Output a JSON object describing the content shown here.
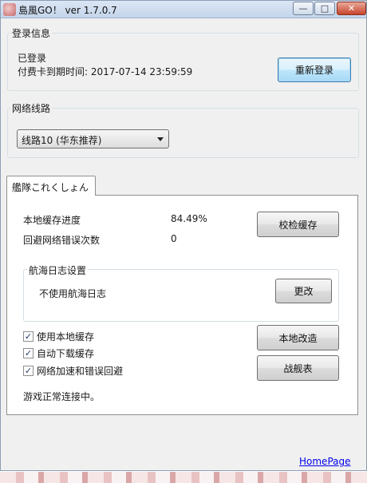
{
  "window": {
    "title": "島風GO！ ver 1.7.0.7",
    "min_glyph": "—",
    "max_glyph": "□",
    "close_glyph": "✕"
  },
  "login": {
    "legend": "登录信息",
    "status": "已登录",
    "expiry_text": "付费卡到期时间: 2017-07-14 23:59:59",
    "relogin_label": "重新登录"
  },
  "network": {
    "legend": "网络线路",
    "selected": "线路10 (华东推荐)"
  },
  "tab": {
    "label": "艦隊これくしょん",
    "cache_progress_label": "本地缓存进度",
    "cache_progress_value": "84.49%",
    "error_count_label": "回避网络错误次数",
    "error_count_value": "0",
    "verify_cache_label": "校检缓存",
    "log_legend": "航海日志设置",
    "log_status": "不使用航海日志",
    "change_label": "更改",
    "local_mod_label": "本地改造",
    "ship_list_label": "战舰表",
    "checkboxes": [
      {
        "label": "使用本地缓存",
        "checked": true
      },
      {
        "label": "自动下载缓存",
        "checked": true
      },
      {
        "label": "网络加速和错误回避",
        "checked": true
      }
    ],
    "check_glyph": "✓",
    "status_text": "游戏正常连接中。"
  },
  "footer": {
    "homepage_link": "HomePage"
  }
}
